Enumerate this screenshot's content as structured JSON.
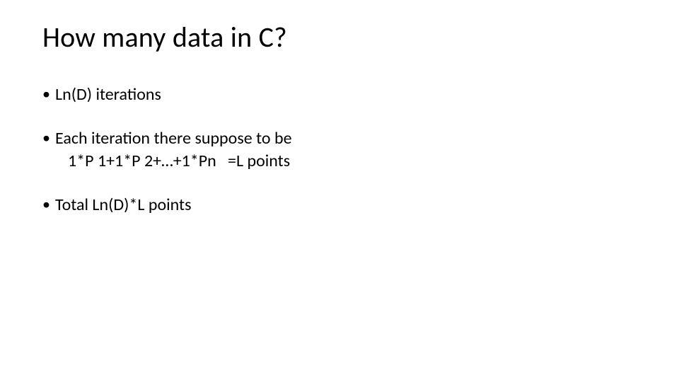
{
  "slide": {
    "title": "How many data in C?",
    "bullets": [
      {
        "lines": [
          "Ln(D) iterations"
        ]
      },
      {
        "lines": [
          "Each iteration there suppose to be",
          "1*P 1+1*P 2+…+1*Pn   =L points"
        ]
      },
      {
        "lines": [
          "Total Ln(D)*L points"
        ]
      }
    ]
  }
}
